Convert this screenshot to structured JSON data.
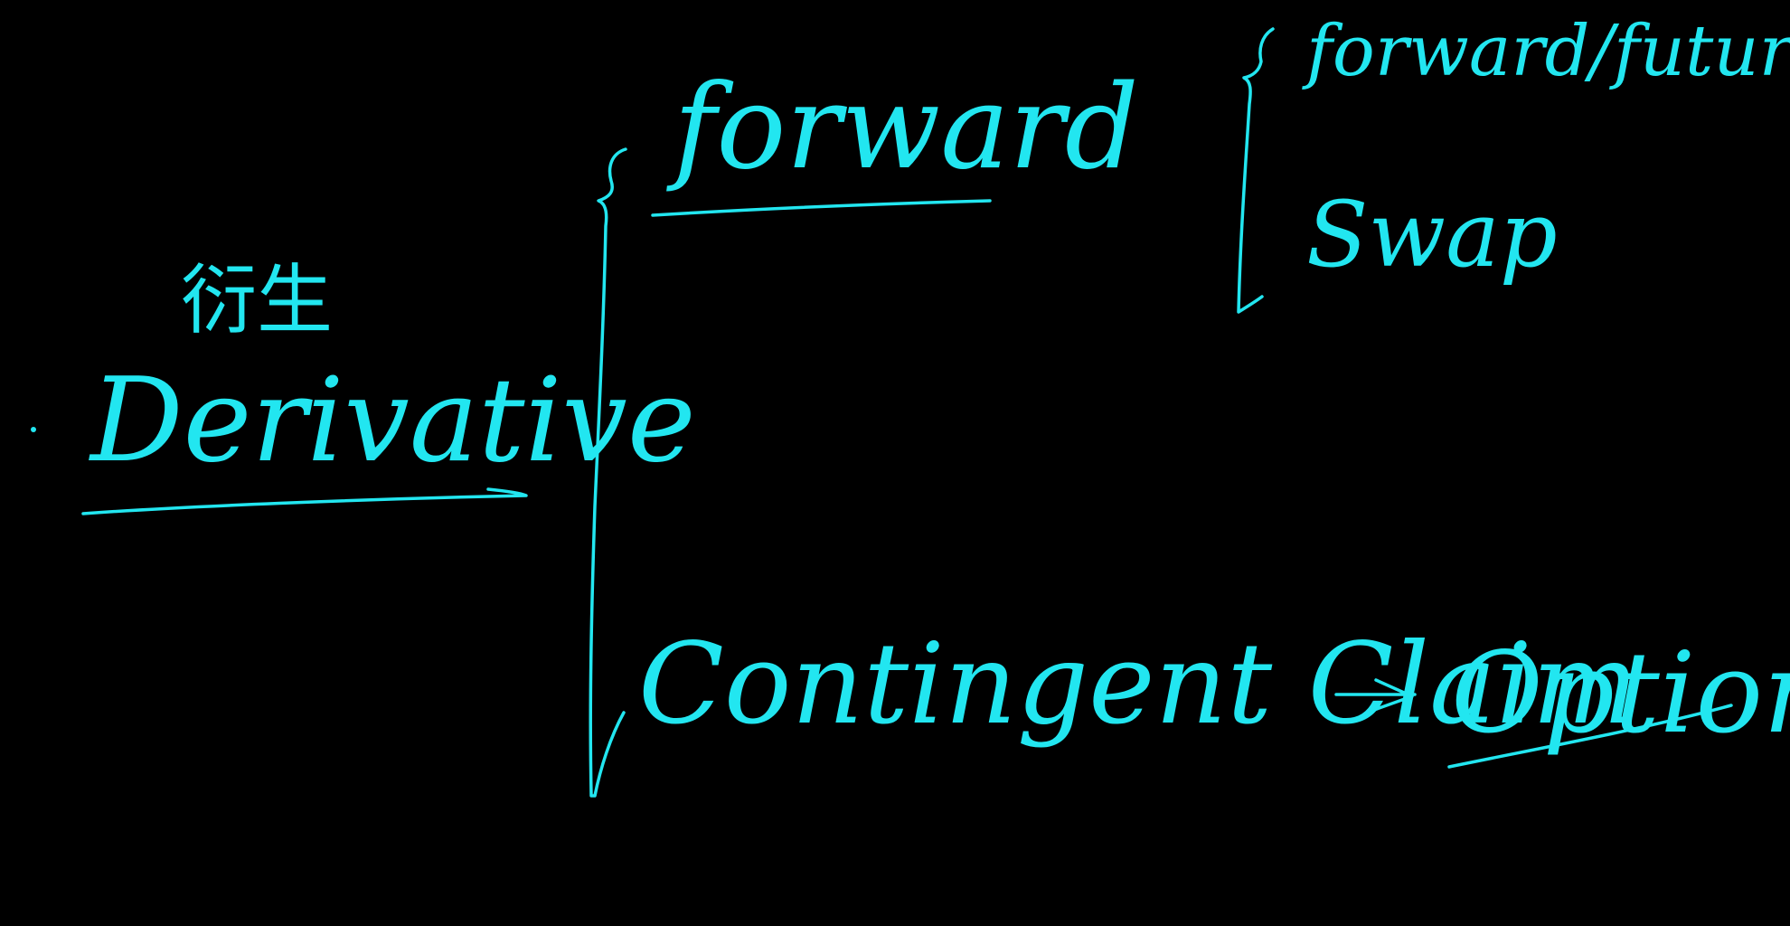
{
  "canvas": {
    "background": "#000000",
    "ink_color": "#22e6f0"
  },
  "notes": {
    "chinese_term": "衍生",
    "derivative": "Derivative",
    "forward": "forward",
    "forward_future": "forward/future",
    "swap": "Swap",
    "contingent_claim": "Contingent Claim",
    "option": "Option"
  }
}
